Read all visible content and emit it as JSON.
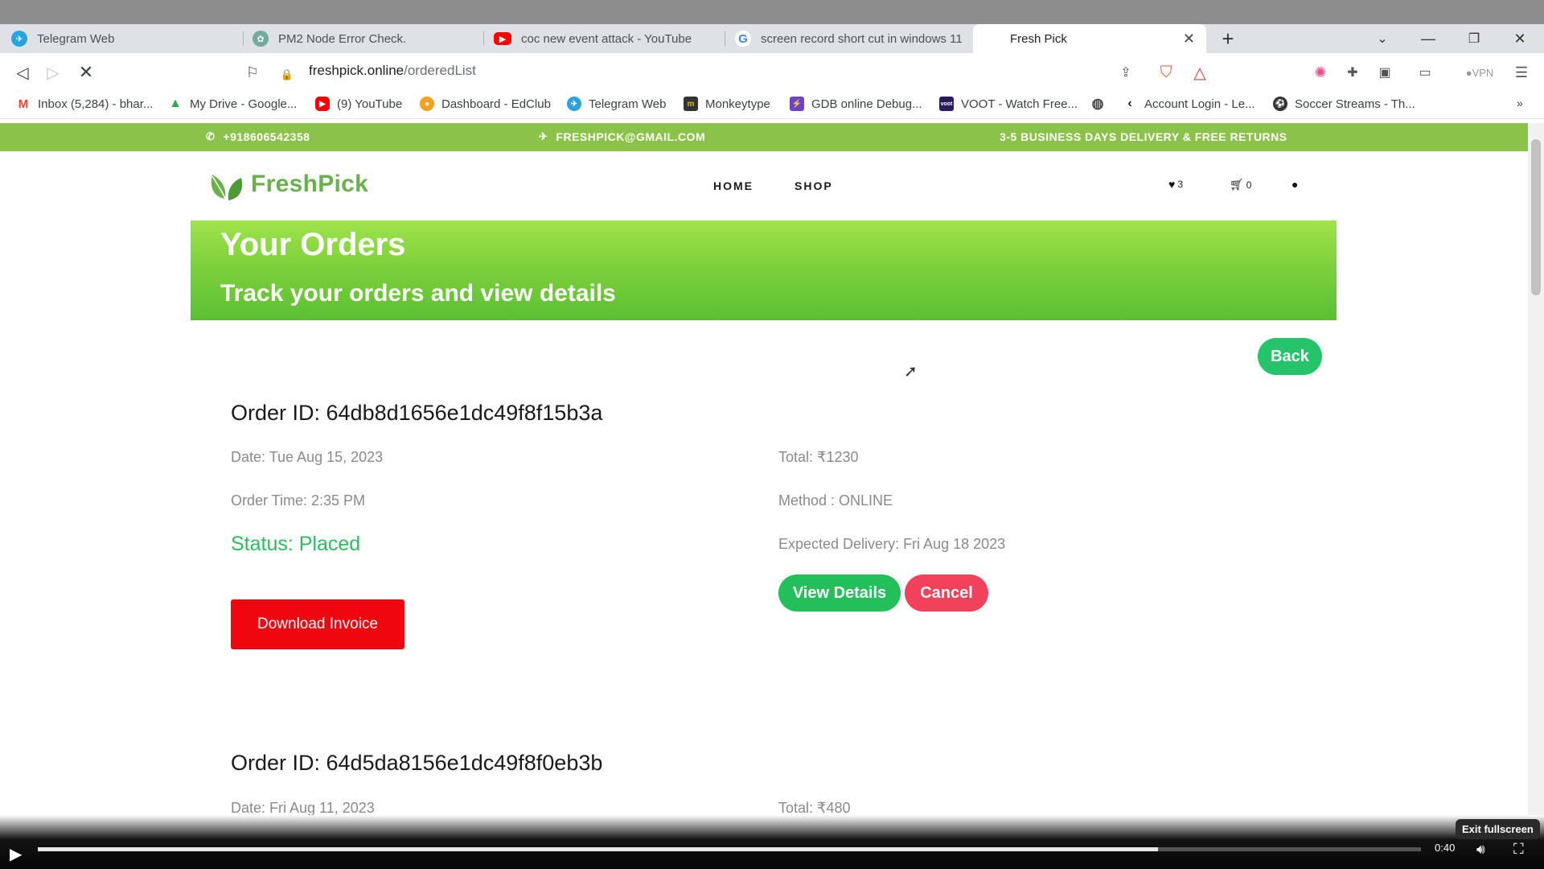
{
  "browser": {
    "tabs": [
      {
        "label": "Telegram Web",
        "icon": "telegram-icon"
      },
      {
        "label": "PM2 Node Error Check.",
        "icon": "chatgpt-icon"
      },
      {
        "label": "coc new event attack - YouTube",
        "icon": "youtube-icon"
      },
      {
        "label": "screen record short cut in windows 11",
        "icon": "google-icon"
      },
      {
        "label": "Fresh Pick",
        "icon": "page-icon"
      }
    ],
    "url_domain": "freshpick.online",
    "url_path": "/orderedList",
    "vpn_label": "VPN",
    "brave_badge": "1",
    "rewards_badge": "1",
    "bookmarks": [
      {
        "label": "Inbox (5,284) - bhar...",
        "icon": "gmail-icon"
      },
      {
        "label": "My Drive - Google...",
        "icon": "drive-icon"
      },
      {
        "label": "(9) YouTube",
        "icon": "youtube-icon"
      },
      {
        "label": "Dashboard - EdClub",
        "icon": "edclub-icon"
      },
      {
        "label": "Telegram Web",
        "icon": "telegram-icon"
      },
      {
        "label": "Monkeytype",
        "icon": "monkeytype-icon"
      },
      {
        "label": "GDB online Debug...",
        "icon": "gdb-icon"
      },
      {
        "label": "VOOT - Watch Free...",
        "icon": "voot-icon"
      },
      {
        "label": "",
        "icon": "globe-icon"
      },
      {
        "label": "Account Login - Le...",
        "icon": "leetcode-icon"
      },
      {
        "label": "Soccer Streams - Th...",
        "icon": "soccer-icon"
      }
    ]
  },
  "site": {
    "topbar": {
      "phone": "+918606542358",
      "email": "FRESHPICK@GMAIL.COM",
      "delivery": "3-5 BUSINESS DAYS DELIVERY & FREE RETURNS"
    },
    "brand": "FreshPick",
    "nav": {
      "home": "HOME",
      "shop": "SHOP"
    },
    "wishlist_count": "3",
    "cart_count": "0",
    "banner": {
      "title": "Your Orders",
      "subtitle": "Track your orders and view details"
    },
    "back_label": "Back",
    "orders": [
      {
        "id": "Order ID: 64db8d1656e1dc49f8f15b3a",
        "date": "Date: Tue Aug 15, 2023",
        "total": "Total: ₹1230",
        "time": "Order Time: 2:35 PM",
        "method": "Method : ONLINE",
        "status": "Status: Placed",
        "expected": "Expected Delivery: Fri Aug 18 2023",
        "invoice_label": "Download Invoice",
        "details_label": "View Details",
        "cancel_label": "Cancel"
      },
      {
        "id": "Order ID: 64d5da8156e1dc49f8f0eb3b",
        "date": "Date: Fri Aug 11, 2023",
        "total": "Total: ₹480"
      }
    ]
  },
  "player": {
    "exit_fullscreen": "Exit fullscreen",
    "time": "0:40",
    "progress_fraction": 0.81
  },
  "colors": {
    "brand_green": "#8bc34a",
    "status_green": "#2ebc5d",
    "invoice_red": "#f0060f",
    "cancel_red": "#f2415a"
  }
}
